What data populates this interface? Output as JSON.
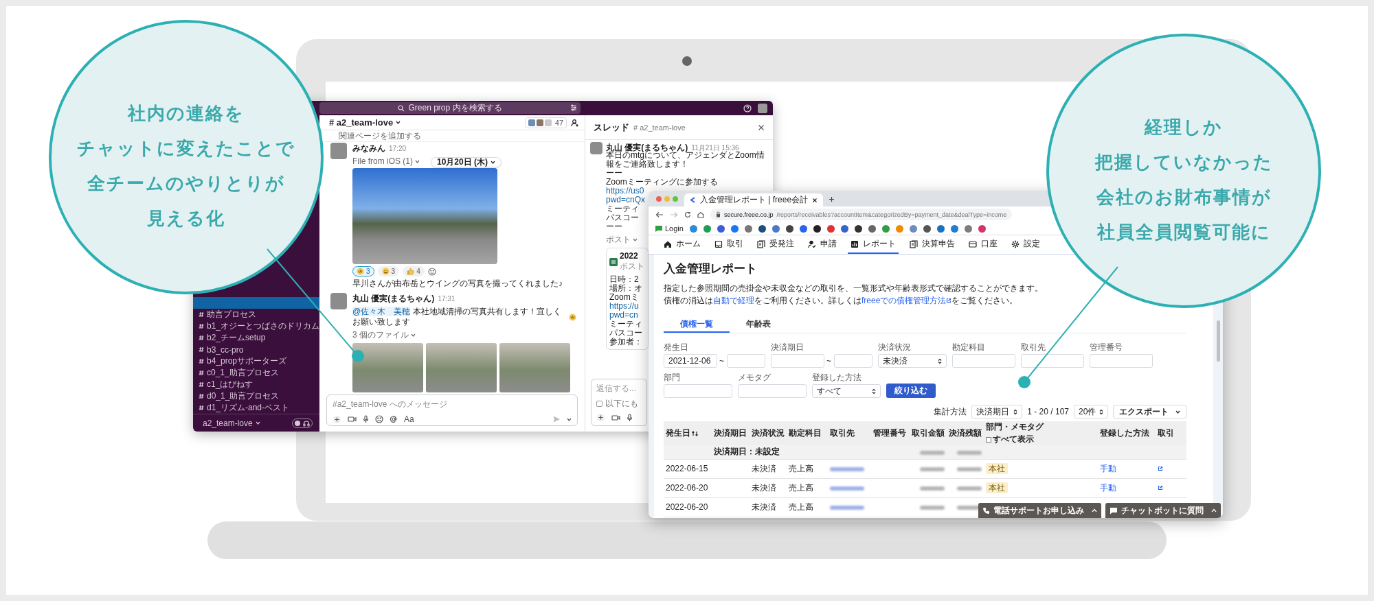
{
  "callouts": [
    {
      "lines": [
        "社内の連絡を",
        "チャットに変えたことで",
        "全チームのやりとりが",
        "見える化"
      ]
    },
    {
      "lines": [
        "経理しか",
        "把握していなかった",
        "会社のお財布事情が",
        "社員全員閲覧可能に"
      ]
    }
  ],
  "slack": {
    "search_placeholder": "Green prop 内を検索する",
    "channel_title": "# a2_team-love",
    "member_count": "47",
    "bookmark_link": "関連ページを追加する",
    "sidebar_channels": [
      {
        "selected": true
      },
      {
        "label": "助言プロセス",
        "selected": false
      },
      {
        "label": "b1_オジーとつばさのドリカム",
        "selected": false
      },
      {
        "label": "b2_チームsetup",
        "selected": false
      },
      {
        "label": "b3_cc-pro",
        "selected": false
      },
      {
        "label": "b4_propサポーターズ",
        "selected": false
      },
      {
        "label": "c0_1_助言プロセス",
        "selected": false
      },
      {
        "label": "c1_はぴねす",
        "selected": false
      },
      {
        "label": "d0_1_助言プロセス",
        "selected": false
      },
      {
        "label": "d1_リズム-and-ベスト",
        "selected": false
      }
    ],
    "workspace": "a2_team-love",
    "huddle_on": false,
    "date_divider": "10月20日 (木)",
    "messages": [
      {
        "author": "みなみん",
        "time": "17:20",
        "file_label": "File from iOS (1)",
        "attachments": [
          {
            "kind": "photo"
          }
        ],
        "reactions": [
          {
            "count": "3",
            "selected": true
          },
          {
            "count": "3",
            "selected": false
          },
          {
            "count": "4",
            "selected": false
          }
        ],
        "text": "早川さんが由布岳とウイングの写真を撮ってくれました♪",
        "ends_with_emoji": false
      },
      {
        "author": "丸山 優実(まるちゃん)",
        "time": "17:31",
        "mention": "@佐々木　美穂",
        "text": "本社地域清掃の写真共有します！宜しくお願い致します",
        "ends_with_emoji": true,
        "file_label": "3 個のファイル",
        "attachments": [
          {
            "kind": "photo"
          },
          {
            "kind": "photo"
          },
          {
            "kind": "photo"
          }
        ]
      }
    ],
    "composer_placeholder": "#a2_team-love へのメッセージ",
    "format_label": "Aa",
    "thread": {
      "title": "スレッド",
      "channel": "# a2_team-love",
      "author": "丸山 優実(まるちゃん)",
      "time": "11月21日 15:36",
      "lines": [
        {
          "kind": "text",
          "text": "本日のmtgについて、アジェンダとZoom情報をご連絡致します！"
        },
        {
          "kind": "text",
          "text": "ーー"
        },
        {
          "kind": "text",
          "text": "Zoomミーティングに参加する"
        },
        {
          "kind": "link",
          "text": "https://us0"
        },
        {
          "kind": "link",
          "text": "pwd=cnQx"
        },
        {
          "kind": "text",
          "text": "ミーティ"
        },
        {
          "kind": "text",
          "text": "パスコー"
        },
        {
          "kind": "text",
          "text": "ーー"
        }
      ],
      "post_label": "ポスト",
      "post": {
        "title": "2022",
        "subtitle": "ポスト",
        "lines": [
          {
            "kind": "text",
            "text": "日時：2"
          },
          {
            "kind": "text",
            "text": "場所：オ"
          },
          {
            "kind": "text",
            "text": "Zoomミ"
          },
          {
            "kind": "link",
            "text": "https://u"
          },
          {
            "kind": "link",
            "text": "pwd=cn"
          },
          {
            "kind": "text",
            "text": "ミーティ"
          },
          {
            "kind": "text",
            "text": "パスコー"
          },
          {
            "kind": "text",
            "text": "参加者："
          }
        ]
      },
      "reply_placeholder": "返信する...",
      "also_post_label": "以下にも",
      "also_post_checked": false
    }
  },
  "freee": {
    "tab_title": "入金管理レポート | freee会計",
    "url_host": "secure.freee.co.jp",
    "url_path": "/reports/receivables?accountItem&categorizedBy=payment_date&dealType=income",
    "bookmark_label": "Login",
    "nav": [
      {
        "label": "ホーム",
        "selected": false
      },
      {
        "label": "取引",
        "selected": false
      },
      {
        "label": "受発注",
        "selected": false
      },
      {
        "label": "申請",
        "selected": false
      },
      {
        "label": "レポート",
        "selected": true
      },
      {
        "label": "決算申告",
        "selected": false
      },
      {
        "label": "口座",
        "selected": false
      },
      {
        "label": "設定",
        "selected": false
      }
    ],
    "title": "入金管理レポート",
    "description": "指定した参照期間の売掛金や未収金などの取引を、一覧形式や年齢表形式で確認することができます。",
    "help_line": [
      {
        "kind": "text",
        "text": "債権の消込は"
      },
      {
        "kind": "link",
        "text": "自動で経理"
      },
      {
        "kind": "text",
        "text": "をご利用ください。詳しくは"
      },
      {
        "kind": "external_link",
        "text": "freeeでの債権管理方法"
      },
      {
        "kind": "text",
        "text": "をご覧ください。"
      }
    ],
    "tabs": [
      {
        "label": "債権一覧",
        "selected": true
      },
      {
        "label": "年齢表",
        "selected": false
      }
    ],
    "filter_rows": [
      [
        {
          "label": "発生日",
          "kind": "range",
          "value": "2021-12-06",
          "separator": "~"
        },
        {
          "label": "決済期日",
          "kind": "range",
          "separator": "~"
        },
        {
          "label": "決済状況",
          "kind": "select",
          "value": "未決済"
        },
        {
          "label": "勘定科目",
          "kind": "text"
        },
        {
          "label": "取引先",
          "kind": "text"
        },
        {
          "label": "管理番号",
          "kind": "text"
        }
      ],
      [
        {
          "label": "部門",
          "kind": "text"
        },
        {
          "label": "メモタグ",
          "kind": "text"
        },
        {
          "label": "登録した方法",
          "kind": "select",
          "value": "すべて"
        }
      ]
    ],
    "filter_button": "絞り込む",
    "summary_label": "集計方法",
    "summary_value": "決済期日",
    "pagination": "1 - 20 / 107",
    "page_size": "20件",
    "export_button": "エクスポート",
    "columns": [
      {
        "label": "発生日",
        "kind": "date",
        "sortable": true
      },
      {
        "label": "決済期日",
        "kind": "due",
        "sortable": false
      },
      {
        "label": "決済状況",
        "kind": "status",
        "sortable": false
      },
      {
        "label": "勘定科目",
        "kind": "account",
        "sortable": false
      },
      {
        "label": "取引先",
        "kind": "partner",
        "sortable": false
      },
      {
        "label": "管理番号",
        "kind": "number",
        "sortable": false
      },
      {
        "label": "取引金額",
        "kind": "amount",
        "sortable": false
      },
      {
        "label": "決済残額",
        "kind": "amount",
        "sortable": false
      },
      {
        "label": "部門・メモタグ",
        "kind": "tags",
        "sortable": false,
        "checkbox_label": "すべて表示",
        "checked": false
      },
      {
        "label": "登録した方法",
        "kind": "method",
        "sortable": false
      },
      {
        "label": "取引",
        "kind": "action",
        "sortable": false
      }
    ],
    "group_row": "決済期日：未設定",
    "rows": [
      {
        "date": "2022-06-15",
        "status": "未決済",
        "account": "売上高",
        "tag": "本社",
        "method": "手動"
      },
      {
        "date": "2022-06-20",
        "status": "未決済",
        "account": "売上高",
        "tag": "本社",
        "method": "手動"
      },
      {
        "date": "2022-06-20",
        "status": "未決済",
        "account": "売上高"
      }
    ],
    "support_buttons": [
      {
        "label": "電話サポートお申し込み"
      },
      {
        "label": "チャットボットに質問"
      }
    ]
  }
}
